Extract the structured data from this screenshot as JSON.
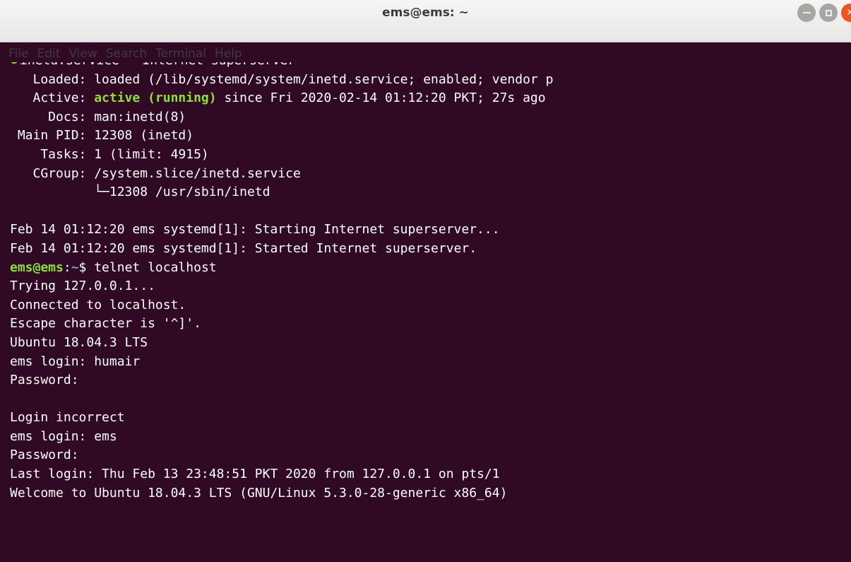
{
  "window": {
    "title": "ems@ems: ~",
    "colors": {
      "terminal_bg": "#300a24",
      "text": "#ffffff",
      "green": "#8ae234",
      "blue": "#729fcf",
      "close": "#e9541f"
    }
  },
  "menu": [
    "File",
    "Edit",
    "View",
    "Search",
    "Terminal",
    "Help"
  ],
  "terminal": {
    "status_line": "inetd.service - Internet superserver",
    "loaded": "   Loaded: loaded (/lib/systemd/system/inetd.service; enabled; vendor p",
    "active_label": "   Active: ",
    "active_state": "active (running)",
    "active_rest": " since Fri 2020-02-14 01:12:20 PKT; 27s ago",
    "docs": "     Docs: man:inetd(8)",
    "main_pid": " Main PID: 12308 (inetd)",
    "tasks": "    Tasks: 1 (limit: 4915)",
    "cgroup": "   CGroup: /system.slice/inetd.service",
    "cgroup_child": "           └─12308 /usr/sbin/inetd",
    "log1": "Feb 14 01:12:20 ems systemd[1]: Starting Internet superserver...",
    "log2": "Feb 14 01:12:20 ems systemd[1]: Started Internet superserver.",
    "prompt_user": "ems@ems",
    "prompt_colon": ":",
    "prompt_path": "~",
    "prompt_cmd": "$ telnet localhost",
    "out_lines": [
      "Trying 127.0.0.1...",
      "Connected to localhost.",
      "Escape character is '^]'.",
      "Ubuntu 18.04.3 LTS",
      "ems login: humair",
      "Password:",
      "",
      "Login incorrect",
      "ems login: ems",
      "Password:",
      "Last login: Thu Feb 13 23:48:51 PKT 2020 from 127.0.0.1 on pts/1",
      "Welcome to Ubuntu 18.04.3 LTS (GNU/Linux 5.3.0-28-generic x86_64)"
    ]
  }
}
